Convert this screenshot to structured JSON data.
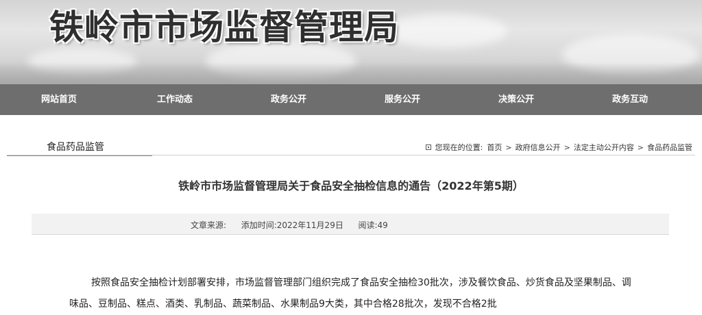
{
  "header": {
    "site_title": "铁岭市市场监督管理局"
  },
  "nav": {
    "items": [
      {
        "label": "网站首页"
      },
      {
        "label": "工作动态"
      },
      {
        "label": "政务公开"
      },
      {
        "label": "服务公开"
      },
      {
        "label": "决策公开"
      },
      {
        "label": "政务互动"
      }
    ]
  },
  "section": {
    "title": "食品药品监管"
  },
  "breadcrumb": {
    "prefix": "您现在的位置:",
    "items": [
      "首页",
      "政府信息公开",
      "法定主动公开内容",
      "食品药品监管"
    ],
    "separator": ">"
  },
  "article": {
    "title": "铁岭市市场监督管理局关于食品安全抽检信息的通告（2022年第5期）",
    "meta": {
      "source_label": "文章来源:",
      "source_value": "",
      "date_label": "添加时间:",
      "date_value": "2022年11月29日",
      "reads_label": "阅读:",
      "reads_value": "49"
    },
    "body": "按照食品安全抽检计划部署安排，市场监督管理部门组织完成了食品安全抽检30批次，涉及餐饮食品、炒货食品及坚果制品、调味品、豆制品、糕点、酒类、乳制品、蔬菜制品、水果制品9大类，其中合格28批次，发现不合格2批"
  },
  "colors": {
    "nav_bg": "#6e6e6e",
    "meta_bg": "#f2f2f2",
    "text": "#333333"
  }
}
